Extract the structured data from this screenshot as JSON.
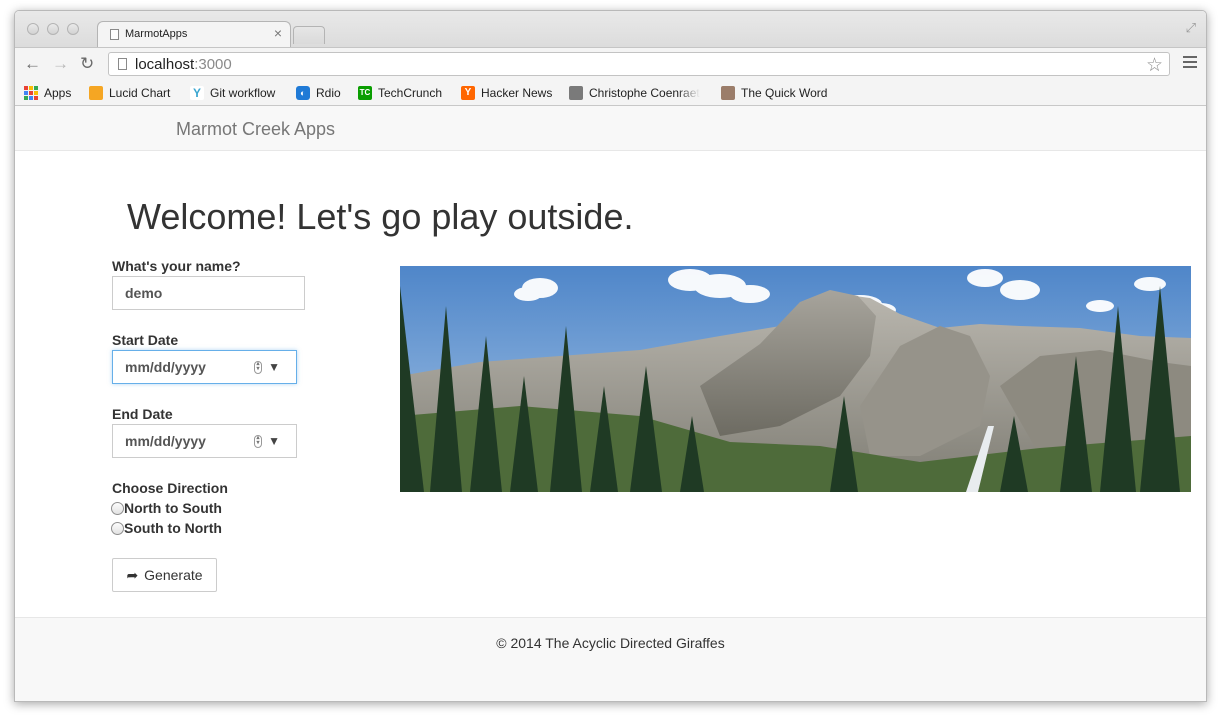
{
  "browser": {
    "tab_title": "MarmotApps",
    "tab_close": "×",
    "url_host": "localhost",
    "url_port": ":3000",
    "bookmarks": [
      {
        "label": "Apps"
      },
      {
        "label": "Lucid Chart"
      },
      {
        "label": "Git workflow"
      },
      {
        "label": "Rdio"
      },
      {
        "label": "TechCrunch"
      },
      {
        "label": "Hacker News"
      },
      {
        "label": "Christophe Coenraet"
      },
      {
        "label": "The Quick Word"
      }
    ],
    "icons": [
      "back-arrow-icon",
      "forward-arrow-icon",
      "reload-icon",
      "page-icon",
      "star-icon",
      "menu-icon",
      "fullscreen-icon"
    ]
  },
  "navbar": {
    "brand": "Marmot Creek Apps"
  },
  "main": {
    "heading": "Welcome! Let's go play outside.",
    "name_label": "What's your name?",
    "name_value": "demo",
    "start_label": "Start Date",
    "start_placeholder": "mm/dd/yyyy",
    "end_label": "End Date",
    "end_placeholder": "mm/dd/yyyy",
    "direction_label": "Choose Direction",
    "directions": [
      {
        "label": "North to South"
      },
      {
        "label": "South to North"
      }
    ],
    "generate_label": "Generate"
  },
  "footer": {
    "text": "© 2014 The Acyclic Directed Giraffes"
  },
  "colors": {
    "focus_border": "#66afe9",
    "navbar_bg": "#f8f8f8",
    "text": "#333333"
  }
}
